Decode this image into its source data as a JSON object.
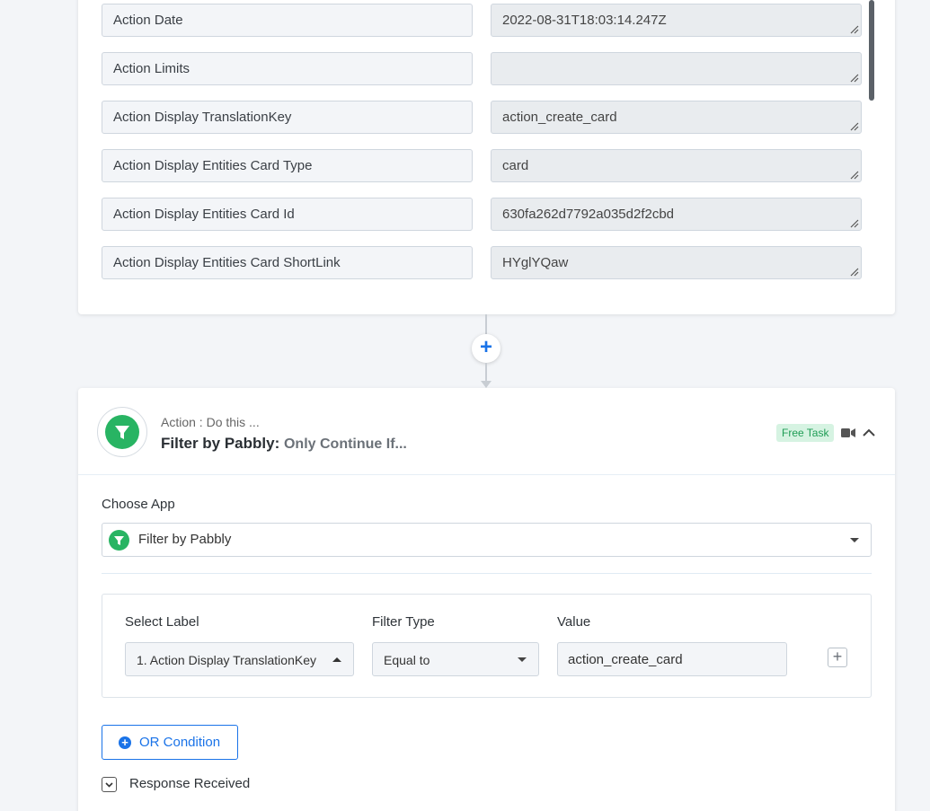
{
  "response_fields": [
    {
      "label": "Action Date",
      "value": "2022-08-31T18:03:14.247Z"
    },
    {
      "label": "Action Limits",
      "value": ""
    },
    {
      "label": "Action Display TranslationKey",
      "value": "action_create_card"
    },
    {
      "label": "Action Display Entities Card Type",
      "value": "card"
    },
    {
      "label": "Action Display Entities Card Id",
      "value": "630fa262d7792a035d2f2cbd"
    },
    {
      "label": "Action Display Entities Card ShortLink",
      "value": "HYglYQaw"
    }
  ],
  "connector": {
    "add_icon": "+"
  },
  "action": {
    "subtitle": "Action : Do this ...",
    "app_name": "Filter by Pabbly:",
    "description": "Only Continue If...",
    "badge": "Free Task",
    "icons": {
      "logo": "funnel-icon",
      "video": "video-icon",
      "collapse": "chevron-up-icon"
    },
    "brand_color": "#28b463"
  },
  "choose_app": {
    "label": "Choose App",
    "selected": "Filter by Pabbly"
  },
  "filter": {
    "select_label_header": "Select Label",
    "filter_type_header": "Filter Type",
    "value_header": "Value",
    "selected_label": "1. Action Display TranslationKey",
    "filter_type": "Equal to",
    "value": "action_create_card",
    "add_icon": "+"
  },
  "or_condition": {
    "label": "OR Condition",
    "accent": "#1a73e8"
  },
  "response": {
    "label": "Response Received"
  }
}
